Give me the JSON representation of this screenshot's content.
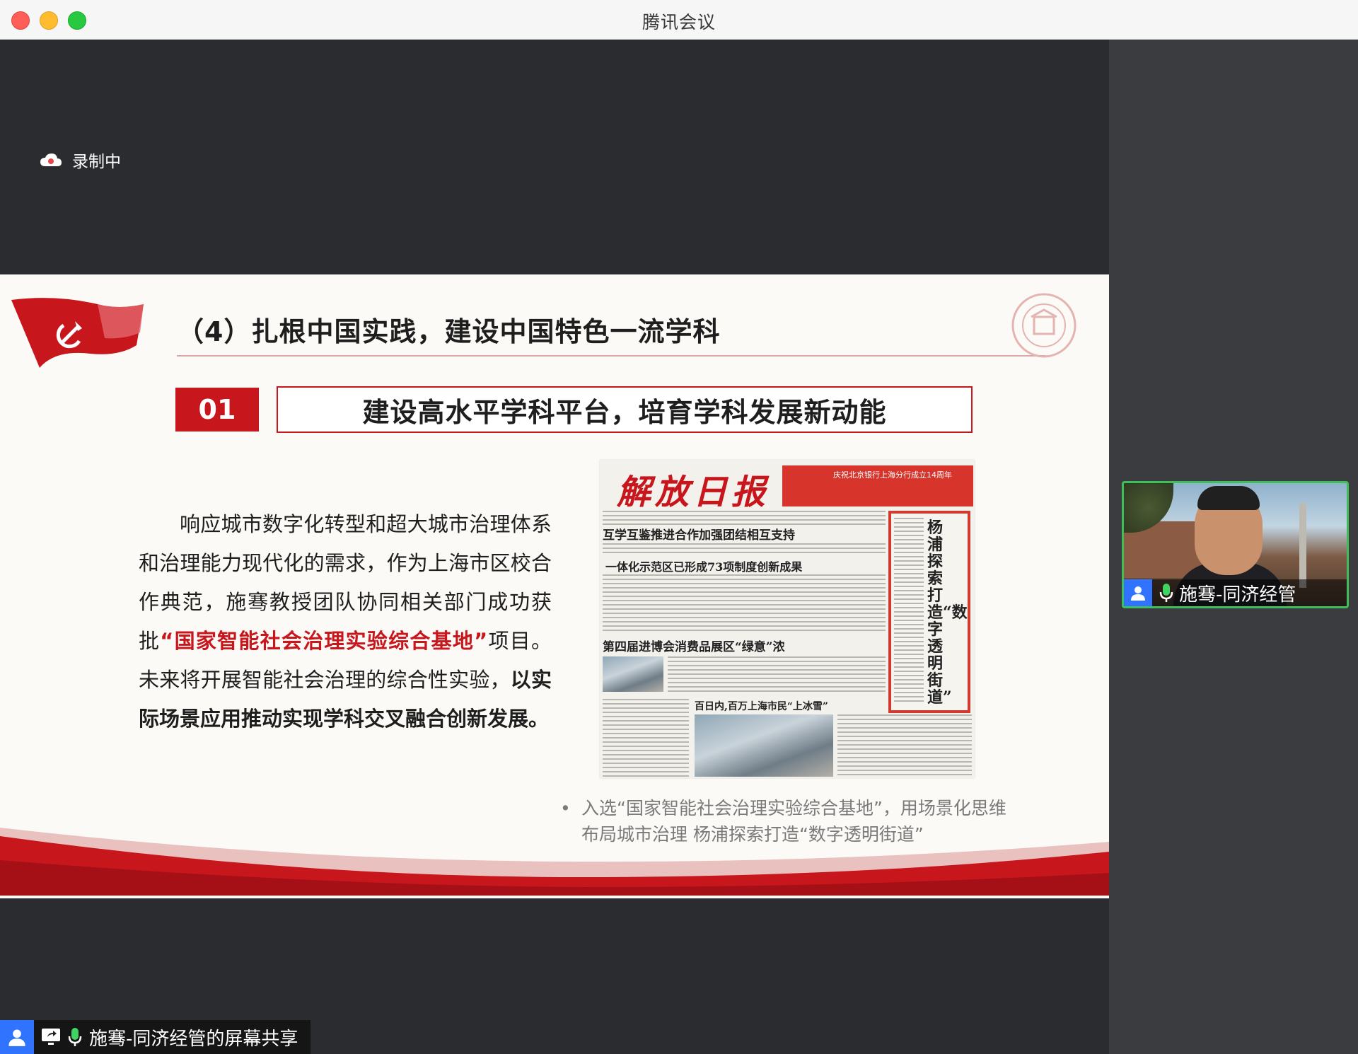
{
  "window": {
    "title": "腾讯会议"
  },
  "recording": {
    "label": "录制中"
  },
  "slide": {
    "title": "（4）扎根中国实践，建设中国特色一流学科",
    "section_number": "01",
    "section_title": "建设高水平学科平台，培育学科发展新动能",
    "body_part1": "响应城市数字化转型和超大城市治理体系和治理能力现代化的需求，作为上海市区校合作典范，施骞教授团队协同相关部门成功获批",
    "body_highlight": "“国家智能社会治理实验综合基地”",
    "body_part2": "项目。未来将开展智能社会治理的综合性实验，",
    "body_bold": "以实际场景应用推动实现学科交叉融合创新发展。",
    "caption": "入选“国家智能社会治理实验综合基地”，用场景化思维布局城市治理 杨浦探索打造“数字透明街道”",
    "newspaper": {
      "masthead": "解放日报",
      "banner": "庆祝北京银行上海分行成立14周年",
      "headline1": "互学互鉴推进合作加强团结相互支持",
      "headline2": "一体化示范区已形成73项制度创新成果",
      "headline3": "第四届进博会消费品展区“绿意”浓",
      "headline4": "百日内,百万上海市民“上冰雪”",
      "side_headline": "杨浦探索打造“数字透明街道”"
    }
  },
  "participant": {
    "name": "施骞-同济经管"
  },
  "share_label": {
    "text": "施骞-同济经管的屏幕共享"
  },
  "colors": {
    "accent_red": "#c8161d",
    "active_speaker": "#3fbf5a",
    "avatar_blue": "#2f73ff"
  }
}
